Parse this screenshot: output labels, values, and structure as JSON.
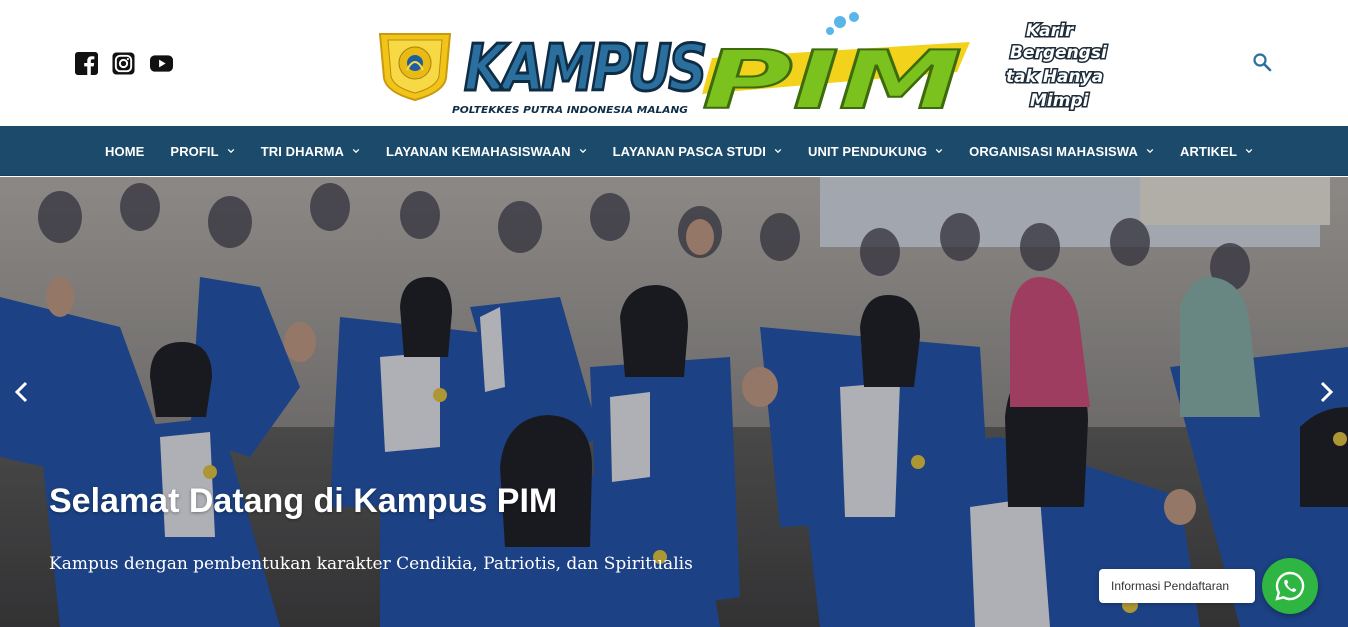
{
  "header": {
    "social_icons": [
      "facebook-icon",
      "instagram-icon",
      "youtube-icon"
    ],
    "logo": {
      "word1": "KAMPUS",
      "word2": "PIM",
      "subtitle": "POLTEKKES PUTRA INDONESIA MALANG",
      "emblem_text": "POLTEKKES PUTRA INDONESIA MALANG"
    },
    "tagline": [
      "Karir",
      "Bergengsi",
      "tak Hanya",
      "Mimpi"
    ],
    "search_icon": "search-icon",
    "colors": {
      "navy": "#1b4a6b",
      "logo_blue": "#2a6f9e",
      "logo_green": "#7cc21f",
      "logo_yellow": "#f2d21b"
    }
  },
  "nav": {
    "items": [
      {
        "label": "HOME",
        "dropdown": false
      },
      {
        "label": "PROFIL",
        "dropdown": true
      },
      {
        "label": "TRI DHARMA",
        "dropdown": true
      },
      {
        "label": "LAYANAN KEMAHASISWAAN",
        "dropdown": true
      },
      {
        "label": "LAYANAN PASCA STUDI",
        "dropdown": true
      },
      {
        "label": "UNIT PENDUKUNG",
        "dropdown": true
      },
      {
        "label": "ORGANISASI MAHASISWA",
        "dropdown": true
      },
      {
        "label": "ARTIKEL",
        "dropdown": true
      }
    ]
  },
  "hero": {
    "title": "Selamat Datang di Kampus PIM",
    "subtitle": "Kampus dengan pembentukan karakter Cendikia, Patriotis, dan Spiritualis",
    "prev_icon": "chevron-left-icon",
    "next_icon": "chevron-right-icon"
  },
  "whatsapp": {
    "label": "Informasi Pendaftaran",
    "icon": "whatsapp-icon",
    "color": "#2fb541"
  }
}
